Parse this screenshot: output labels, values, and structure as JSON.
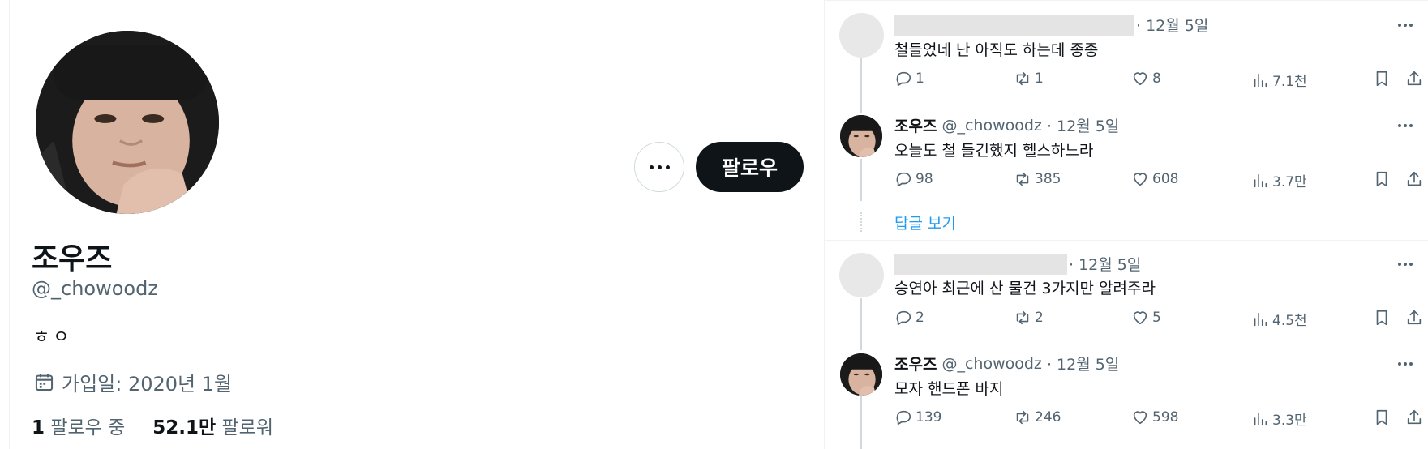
{
  "profile": {
    "display_name": "조우즈",
    "handle": "@_chowoodz",
    "bio": "ㅎㅇ",
    "joined": "가입일: 2020년 1월",
    "following_count": "1",
    "following_label": "팔로우 중",
    "followers_count": "52.1만",
    "followers_label": "팔로워",
    "follow_button": "팔로우"
  },
  "thread": {
    "tweets": [
      {
        "author": "",
        "handle": "",
        "date": "· 12월 5일",
        "text": "철들었네 난 아직도 하는데 종종",
        "replies": "1",
        "retweets": "1",
        "likes": "8",
        "views": "7.1천"
      },
      {
        "author": "조우즈",
        "handle": "@_chowoodz",
        "date": "· 12월 5일",
        "text": "오늘도 철 들긴했지 헬스하느라",
        "replies": "98",
        "retweets": "385",
        "likes": "608",
        "views": "3.7만"
      },
      {
        "author": "",
        "handle": "",
        "date": "· 12월 5일",
        "text": "승연아 최근에 산 물건 3가지만 알려주라",
        "replies": "2",
        "retweets": "2",
        "likes": "5",
        "views": "4.5천"
      },
      {
        "author": "조우즈",
        "handle": "@_chowoodz",
        "date": "· 12월 5일",
        "text": "모자 핸드폰 바지",
        "replies": "139",
        "retweets": "246",
        "likes": "598",
        "views": "3.3만"
      }
    ],
    "show_replies": "답글 보기"
  },
  "icons": {
    "more": "more-horizontal-icon",
    "calendar": "calendar-icon",
    "reply": "reply-icon",
    "retweet": "retweet-icon",
    "like": "heart-icon",
    "views": "views-icon",
    "bookmark": "bookmark-icon",
    "share": "share-icon"
  },
  "colors": {
    "text_primary": "#0f1419",
    "text_secondary": "#536471",
    "link": "#1d9bf0",
    "button_dark": "#0f1419",
    "border": "#cfd9de"
  }
}
